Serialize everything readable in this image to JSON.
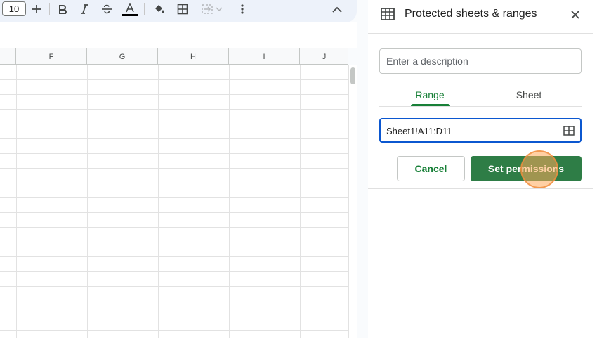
{
  "toolbar": {
    "font_size": "10",
    "icons": [
      "plus-icon",
      "bold-icon",
      "italic-icon",
      "strikethrough-icon",
      "text-color-icon",
      "fill-color-icon",
      "borders-icon",
      "merge-cells-icon",
      "more-vert-icon",
      "chevron-up-icon"
    ],
    "text_color_bar": "#000000"
  },
  "grid": {
    "columns": [
      "F",
      "G",
      "H",
      "I",
      "J"
    ]
  },
  "panel": {
    "title": "Protected sheets & ranges",
    "description_placeholder": "Enter a description",
    "tabs": [
      {
        "label": "Range",
        "active": true
      },
      {
        "label": "Sheet",
        "active": false
      }
    ],
    "range_value": "Sheet1!A11:D11",
    "cancel_label": "Cancel",
    "set_permissions_label": "Set permissions"
  },
  "colors": {
    "accent_green": "#188038",
    "button_green": "#2e7d46",
    "focus_blue": "#0b57d0"
  }
}
